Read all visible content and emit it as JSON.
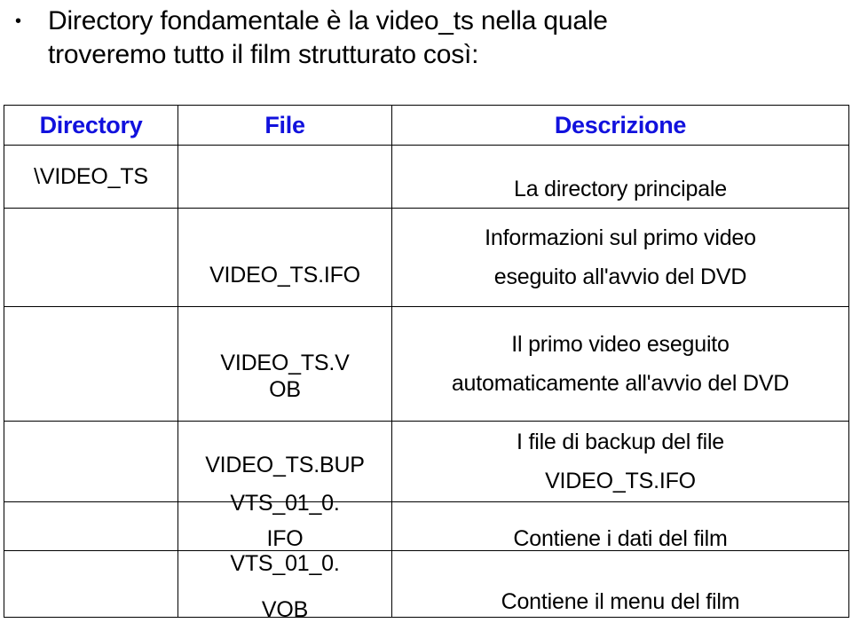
{
  "intro": {
    "bullet_glyph": "•",
    "line1": "Directory fondamentale è la video_ts nella quale",
    "line2": "troveremo tutto il film strutturato così:"
  },
  "table": {
    "header_color": "#1111dd",
    "columns": [
      "Directory",
      "File",
      "Descrizione"
    ],
    "rows": [
      {
        "directory": "\\VIDEO_TS",
        "file": "",
        "description": "La directory principale"
      },
      {
        "directory": "",
        "file": "VIDEO_TS.IFO",
        "description_line1": "Informazioni sul primo video",
        "description_line2": "eseguito all'avvio del DVD"
      },
      {
        "directory": "",
        "file_line1": "VIDEO_TS.V",
        "file_line2": "OB",
        "description_line1": "Il primo video eseguito",
        "description_line2": "automaticamente all'avvio del DVD"
      },
      {
        "directory": "",
        "file": "VIDEO_TS.BUP",
        "description_line1": "I file di backup del file",
        "description_line2": "VIDEO_TS.IFO"
      },
      {
        "directory": "",
        "file_line1": "VTS_01_0.",
        "file_line2": "IFO",
        "description": "Contiene i dati del film"
      },
      {
        "directory": "",
        "file_line1": "VTS_01_0.",
        "file_line2": "VOB",
        "description": "Contiene il menu del film"
      }
    ]
  }
}
